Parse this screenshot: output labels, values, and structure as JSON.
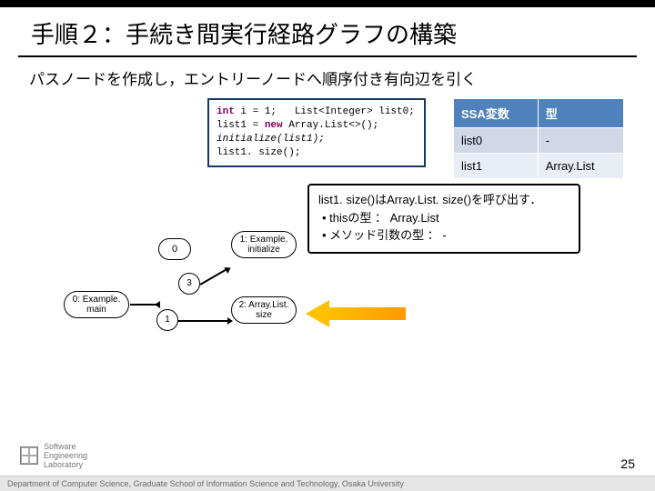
{
  "title": "手順２：手続き間実行経路グラフの構築",
  "subtitle": "パスノードを作成し，エントリーノードへ順序付き有向辺を引く",
  "code": {
    "l1a": "int",
    "l1b": " i = 1;   List<Integer> list0;",
    "l2a": "list1 = ",
    "l2b": "new",
    "l2c": " Array.List<>();",
    "l3": "initialize(list1);",
    "l4": "list1. size();"
  },
  "table": {
    "h1": "SSA変数",
    "h2": "型",
    "r1c1": "list0",
    "r1c2": "-",
    "r2c1": "list1",
    "r2c2": "Array.List"
  },
  "callout": {
    "heading": "list1. size()はArray.List. size()を呼び出す．",
    "b1": "thisの型 ： Array.List",
    "b2": "メソッド引数の型 ： -"
  },
  "nodes": {
    "n0": "0: Example.\nmain",
    "n1": "1: Example.\ninitialize",
    "n2": "2: Array.List.\nsize",
    "n3": "3",
    "n4": "1",
    "bubble": "0"
  },
  "footer": {
    "dept": "Department of Computer Science, Graduate School of Information Science and Technology, Osaka University",
    "pageno": "25",
    "logo_text": "Software\nEngineering\nLaboratory"
  }
}
